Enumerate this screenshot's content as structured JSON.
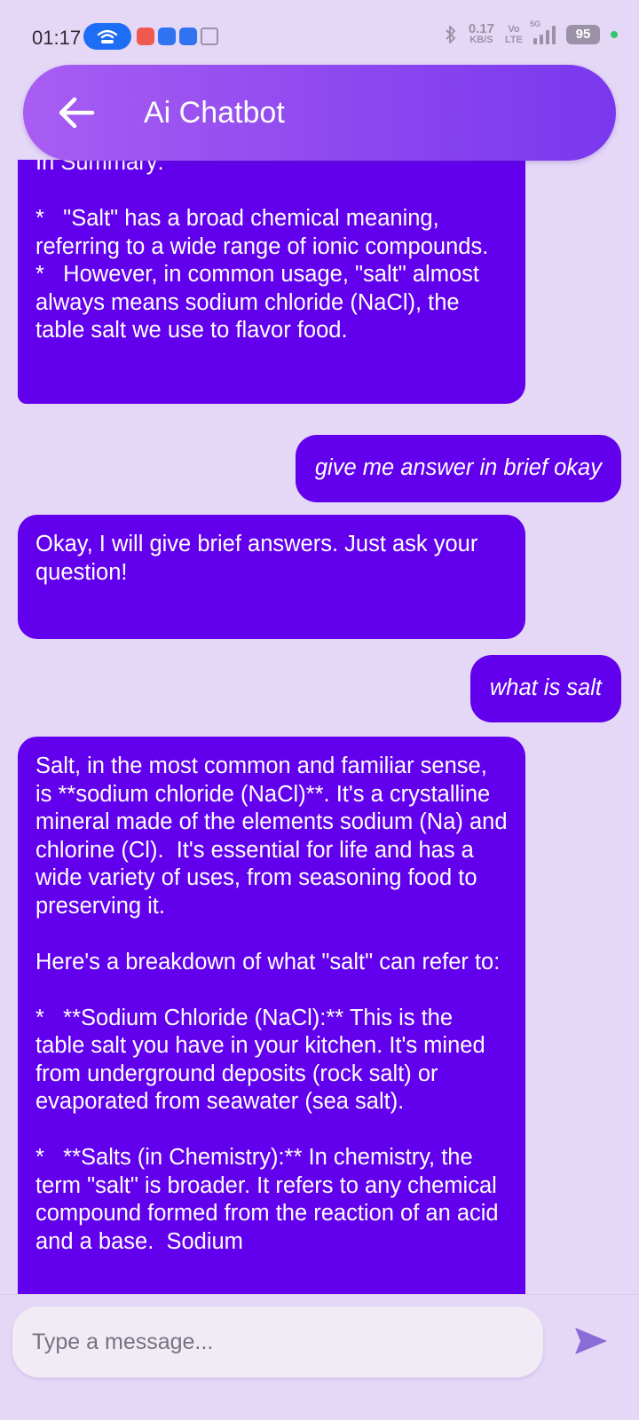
{
  "status_bar": {
    "time": "01:17",
    "net_speed_value": "0.17",
    "net_speed_unit": "KB/S",
    "volte_top": "Vo",
    "volte_bottom": "LTE",
    "network": "5G",
    "battery": "95",
    "notification_icons": [
      "hotspot-icon",
      "gallery-app-icon",
      "pinwheel-app-icon",
      "android-icon",
      "window-icon"
    ]
  },
  "app_bar": {
    "title": "Ai Chatbot",
    "back_icon": "arrow-left-icon",
    "color_start": "#a85df2",
    "color_end": "#7a38ee"
  },
  "messages": [
    {
      "role": "bot",
      "text": "In Summary:\n\n*   \"Salt\" has a broad chemical meaning, referring to a wide range of ionic compounds.\n*   However, in common usage, \"salt\" almost always means sodium chloride (NaCl), the table salt we use to flavor food."
    },
    {
      "role": "user",
      "text": "give me answer in brief okay"
    },
    {
      "role": "bot",
      "text": "Okay, I will give brief answers. Just ask your question!"
    },
    {
      "role": "user",
      "text": "what is salt"
    },
    {
      "role": "bot",
      "text": "Salt, in the most common and familiar sense, is **sodium chloride (NaCl)**. It's a crystalline mineral made of the elements sodium (Na) and chlorine (Cl).  It's essential for life and has a wide variety of uses, from seasoning food to preserving it.\n\nHere's a breakdown of what \"salt\" can refer to:\n\n*   **Sodium Chloride (NaCl):** This is the table salt you have in your kitchen. It's mined from underground deposits (rock salt) or evaporated from seawater (sea salt).\n\n*   **Salts (in Chemistry):** In chemistry, the term \"salt\" is broader. It refers to any chemical compound formed from the reaction of an acid and a base.  Sodium"
    }
  ],
  "input": {
    "placeholder": "Type a message...",
    "value": "",
    "send_icon": "send-icon"
  },
  "colors": {
    "background": "#e5d8f7",
    "bubble": "#6200ee",
    "send_icon": "#8a6cd6"
  }
}
